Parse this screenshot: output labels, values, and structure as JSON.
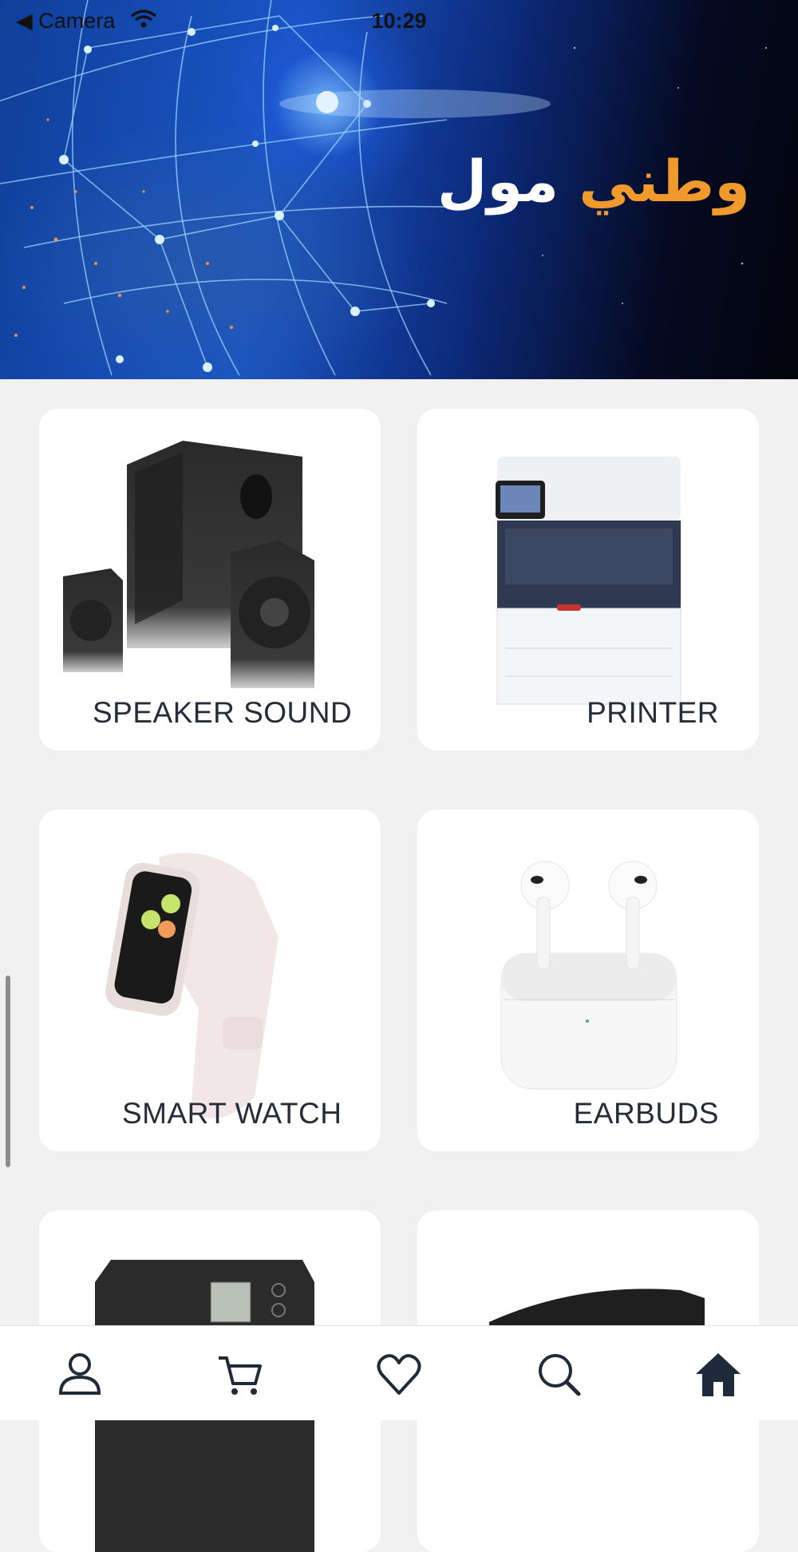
{
  "status_bar": {
    "back_label": "◀ Camera",
    "time": "10:29"
  },
  "banner": {
    "brand_part1": "وطني",
    "brand_part2": "مول"
  },
  "categories": [
    {
      "label": "SPEAKER SOUND",
      "image": "speaker-system"
    },
    {
      "label": "PRINTER",
      "image": "printer"
    },
    {
      "label": "SMART WATCH",
      "image": "smart-watch"
    },
    {
      "label": "EARBUDS",
      "image": "earbuds"
    },
    {
      "label": "",
      "image": "ups-device"
    },
    {
      "label": "",
      "image": "soundbar-device"
    }
  ],
  "nav": [
    "profile-icon",
    "cart-icon",
    "heart-icon",
    "search-icon",
    "home-icon"
  ],
  "colors": {
    "accent": "#f0992c",
    "nav_icon": "#1f2a3a",
    "card": "#ffffff",
    "background": "#f1f1f1"
  }
}
